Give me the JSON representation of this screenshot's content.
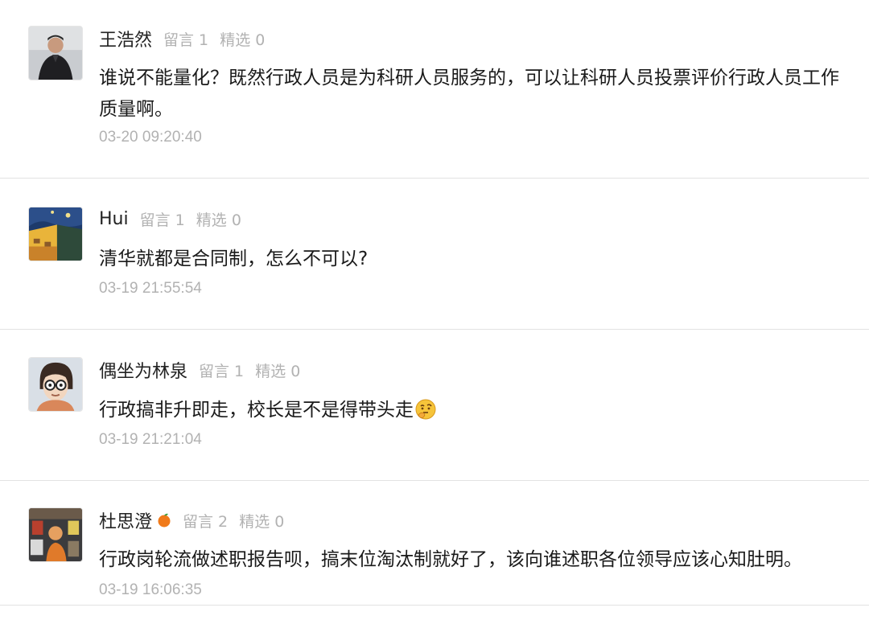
{
  "comments": [
    {
      "name": "王浩然",
      "replies": "留言 1",
      "featured": "精选 0",
      "text": "谁说不能量化？既然行政人员是为科研人员服务的，可以让科研人员投票评价行政人员工作质量啊。",
      "time": "03-20 09:20:40",
      "avatar_icon": "person-portrait-icon"
    },
    {
      "name": "Hui",
      "replies": "留言 1",
      "featured": "精选 0",
      "text": "清华就都是合同制，怎么不可以?",
      "time": "03-19 21:55:54",
      "avatar_icon": "painting-avatar-icon"
    },
    {
      "name": "偶坐为林泉",
      "replies": "留言 1",
      "featured": "精选 0",
      "text": "行政搞非升即走，校长是不是得带头走",
      "emoji": "thinking-face-emoji",
      "time": "03-19 21:21:04",
      "avatar_icon": "cartoon-avatar-icon"
    },
    {
      "name": "杜思澄",
      "name_badge": "orange-icon",
      "replies": "留言 2",
      "featured": "精选 0",
      "text": "行政岗轮流做述职报告呗，搞末位淘汰制就好了，该向谁述职各位领导应该心知肚明。",
      "time": "03-19 16:06:35",
      "avatar_icon": "photo-avatar-icon"
    }
  ],
  "colors": {
    "text": "#1a1a1a",
    "meta": "#b2b2b2",
    "divider": "#e2e2e2",
    "orange": "#f07a1a"
  }
}
